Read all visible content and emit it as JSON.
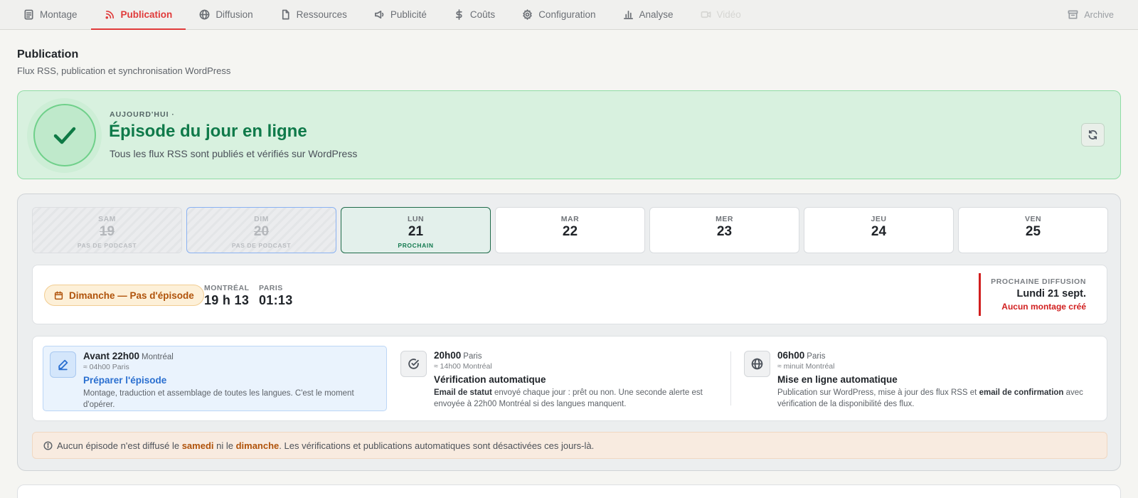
{
  "nav": {
    "tabs": [
      {
        "label": "Montage",
        "icon": "document-icon"
      },
      {
        "label": "Publication",
        "icon": "rss-icon"
      },
      {
        "label": "Diffusion",
        "icon": "globe-icon"
      },
      {
        "label": "Ressources",
        "icon": "file-icon"
      },
      {
        "label": "Publicité",
        "icon": "megaphone-icon"
      },
      {
        "label": "Coûts",
        "icon": "dollar-icon"
      },
      {
        "label": "Configuration",
        "icon": "gear-icon"
      },
      {
        "label": "Analyse",
        "icon": "bar-chart-icon"
      },
      {
        "label": "Vidéo",
        "icon": "video-icon"
      }
    ],
    "active_tab": "Publication",
    "archive_label": "Archive"
  },
  "header": {
    "title": "Publication",
    "subtitle": "Flux RSS, publication et synchronisation WordPress"
  },
  "status_banner": {
    "kicker": "AUJOURD'HUI ·",
    "headline": "Épisode du jour en ligne",
    "description": "Tous les flux RSS sont publiés et vérifiés sur WordPress"
  },
  "days": [
    {
      "name": "SAM",
      "num": "19",
      "note": "PAS DE PODCAST"
    },
    {
      "name": "DIM",
      "num": "20",
      "note": "PAS DE PODCAST"
    },
    {
      "name": "LUN",
      "num": "21",
      "note": "PROCHAIN"
    },
    {
      "name": "MAR",
      "num": "22",
      "note": ""
    },
    {
      "name": "MER",
      "num": "23",
      "note": ""
    },
    {
      "name": "JEU",
      "num": "24",
      "note": ""
    },
    {
      "name": "VEN",
      "num": "25",
      "note": ""
    }
  ],
  "info": {
    "pill_label": "Dimanche — Pas d'épisode",
    "montreal_label": "MONTRÉAL",
    "montreal_time": "19 h 13",
    "paris_label": "PARIS",
    "paris_time": "01:13",
    "next_label": "PROCHAINE DIFFUSION",
    "next_date": "Lundi 21 sept.",
    "next_warning": "Aucun montage créé"
  },
  "steps": [
    {
      "time": "Avant 22h00",
      "city": "Montréal",
      "approx": "≈ 04h00 Paris",
      "title": "Préparer l'épisode",
      "desc": "Montage, traduction et assemblage de toutes les langues. C'est le moment d'opérer."
    },
    {
      "time": "20h00",
      "city": "Paris",
      "approx": "≈ 14h00 Montréal",
      "title": "Vérification automatique",
      "desc_bold": "Email de statut",
      "desc_rest": " envoyé chaque jour : prêt ou non. Une seconde alerte est envoyée à 22h00 Montréal si des langues manquent."
    },
    {
      "time": "06h00",
      "city": "Paris",
      "approx": "≈ minuit Montréal",
      "title": "Mise en ligne automatique",
      "desc_pre": "Publication sur WordPress, mise à jour des flux RSS et ",
      "desc_bold": "email de confirmation",
      "desc_post": " avec vérification de la disponibilité des flux."
    }
  ],
  "note": {
    "pre": "Aucun épisode n'est diffusé le ",
    "hl1": "samedi",
    "mid": " ni le ",
    "hl2": "dimanche",
    "post": ". Les vérifications et publications automatiques sont désactivées ces jours-là."
  },
  "colors": {
    "accent": "#e03a3a",
    "success": "#0f7a4a",
    "warning": "#b0530b",
    "danger": "#d11f1f",
    "info": "#2a6fd0"
  }
}
